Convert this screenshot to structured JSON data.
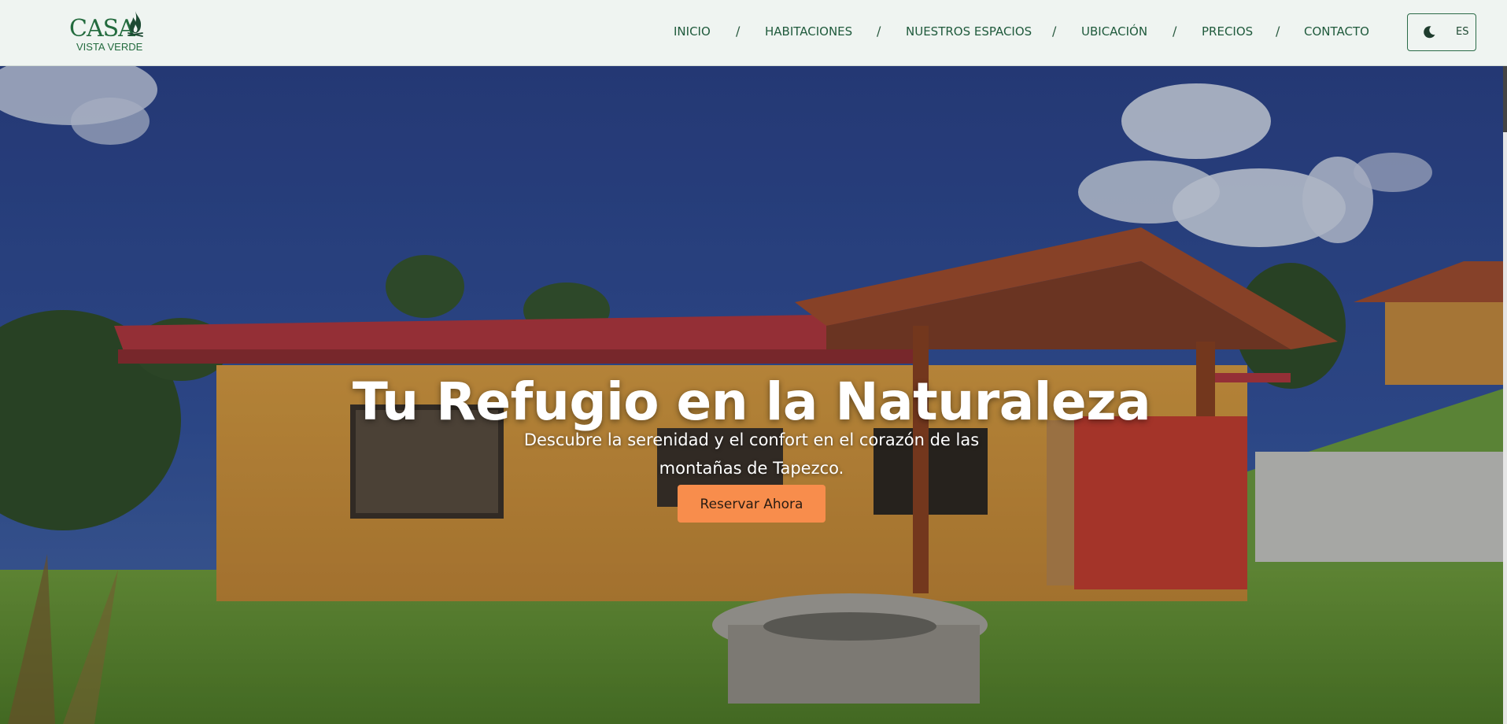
{
  "brand": {
    "name": "CASA",
    "tagline": "VISTA VERDE"
  },
  "nav": {
    "items": [
      {
        "label": "INICIO"
      },
      {
        "label": "HABITACIONES"
      },
      {
        "label": "NUESTROS ESPACIOS"
      },
      {
        "label": "UBICACIÓN"
      },
      {
        "label": "PRECIOS"
      },
      {
        "label": "CONTACTO"
      }
    ],
    "separator": "/"
  },
  "controls": {
    "theme_icon": "moon-icon",
    "language": "ES"
  },
  "hero": {
    "title": "Tu Refugio en la Naturaleza",
    "subtitle": "Descubre la serenidad y el confort en el corazón de las montañas de Tapezco.",
    "cta_label": "Reservar Ahora"
  },
  "colors": {
    "brand_green": "#236b3e",
    "nav_text": "#1f5a3c",
    "cta": "#f88d4c",
    "header_bg": "#eff4f1"
  }
}
